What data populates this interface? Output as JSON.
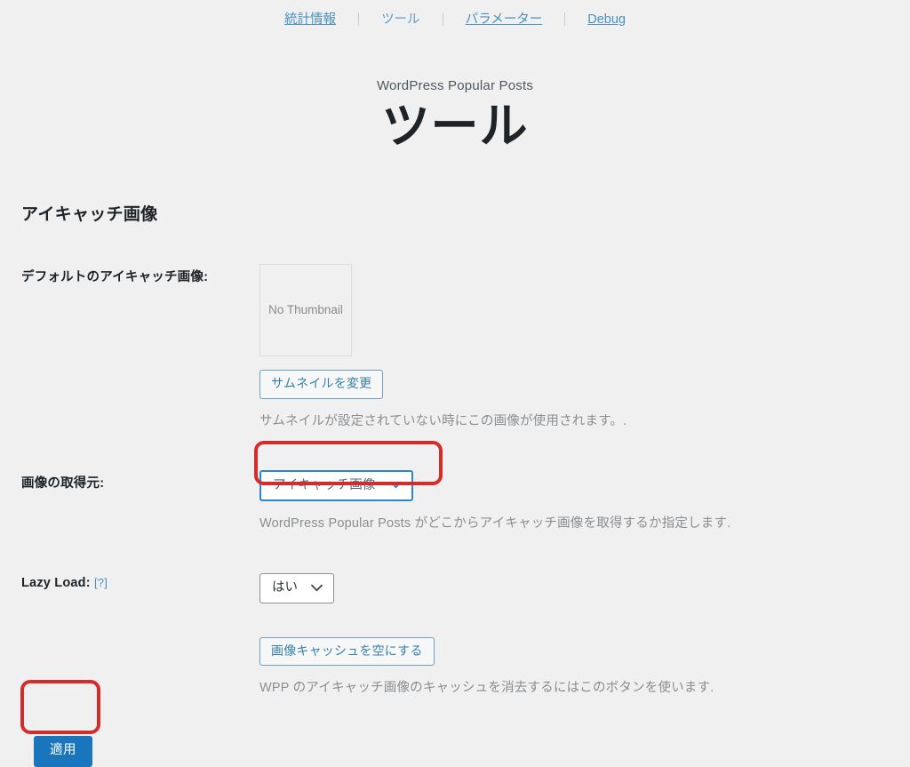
{
  "topnav": {
    "items": [
      {
        "label": "統計情報",
        "current": false
      },
      {
        "label": "ツール",
        "current": true
      },
      {
        "label": "パラメーター",
        "current": false
      },
      {
        "label": "Debug",
        "current": false
      }
    ]
  },
  "header": {
    "plugin_name": "WordPress Popular Posts",
    "title": "ツール"
  },
  "main": {
    "section_title": "アイキャッチ画像",
    "default_thumbnail": {
      "label": "デフォルトのアイキャッチ画像:",
      "placeholder_text": "No Thumbnail",
      "change_button": "サムネイルを変更",
      "description": "サムネイルが設定されていない時にこの画像が使用されます。."
    },
    "image_source": {
      "label": "画像の取得元:",
      "selected": "アイキャッチ画像",
      "options": [
        "アイキャッチ画像"
      ],
      "description": "WordPress Popular Posts がどこからアイキャッチ画像を取得するか指定します."
    },
    "lazy_load": {
      "label": "Lazy Load:",
      "help_label": "[?]",
      "selected": "はい",
      "options": [
        "はい"
      ]
    },
    "image_cache": {
      "button": "画像キャッシュを空にする",
      "description": "WPP のアイキャッチ画像のキャッシュを消去するにはこのボタンを使います."
    },
    "apply_button": "適用"
  },
  "colors": {
    "page_background": "#f0f0f1",
    "link": "#4a8fbd",
    "primary_button": "#1a76bc",
    "annotation_ring": "#d62b2b",
    "focus_border": "#2b87c8"
  }
}
